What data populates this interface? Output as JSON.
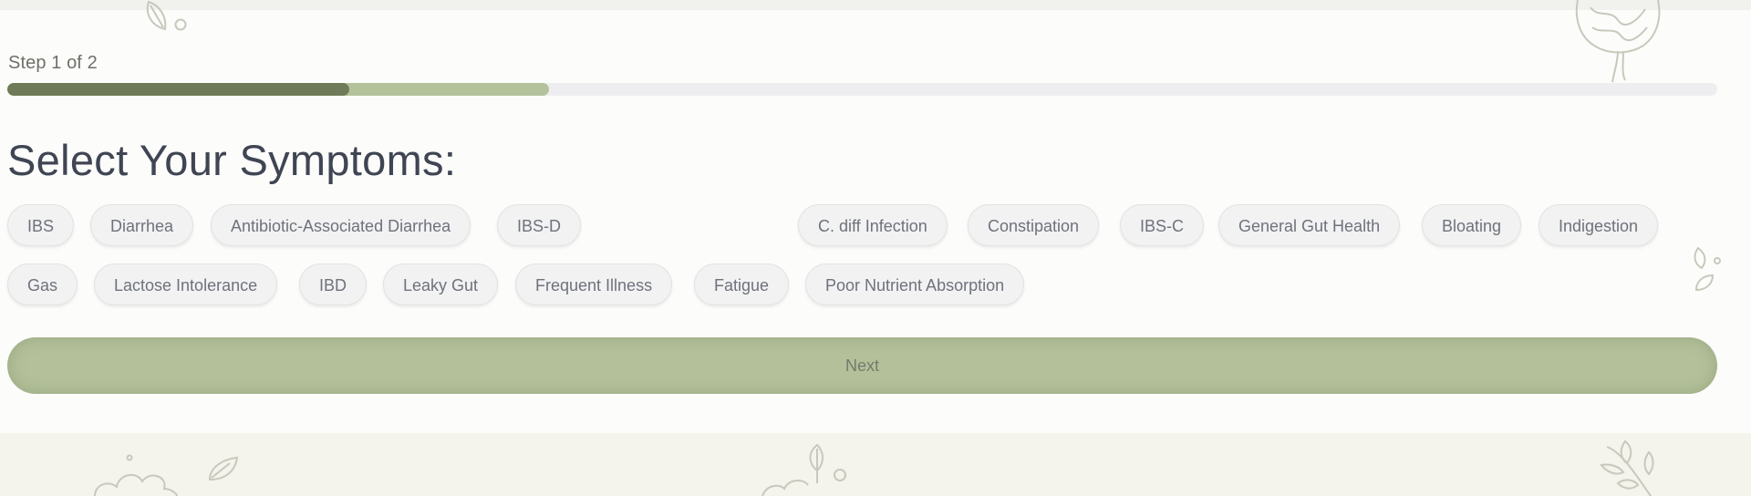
{
  "progress": {
    "step_label": "Step 1 of 2",
    "step_fraction": 0.2,
    "fill_fraction": 0.317
  },
  "heading": "Select Your Symptoms:",
  "symptoms": [
    "IBS",
    "Diarrhea",
    "Antibiotic-Associated Diarrhea",
    "IBS-D",
    "C. diff Infection",
    "Constipation",
    "IBS-C",
    "General Gut Health",
    "Bloating",
    "Indigestion",
    "Gas",
    "Lactose Intolerance",
    "IBD",
    "Leaky Gut",
    "Frequent Illness",
    "Fatigue",
    "Poor Nutrient Absorption"
  ],
  "next_label": "Next",
  "colors": {
    "accent_dark": "#6f7b58",
    "accent_light": "#b3c29b",
    "heading": "#3f4553"
  },
  "decorations": [
    "leaf-icon",
    "intestine-icon",
    "leaf-icon",
    "cloud-icon",
    "leaf-icon",
    "sprig-icon"
  ]
}
